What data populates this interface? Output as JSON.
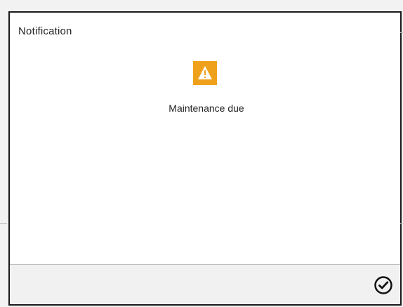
{
  "dialog": {
    "title": "Notification",
    "message": "Maintenance due",
    "icon": "warning-icon",
    "ok_icon": "check-circle-icon"
  },
  "colors": {
    "warning": "#f0a11b",
    "footer": "#f1f1f1",
    "border": "#1a1a1a",
    "divider": "#bdbdbd"
  }
}
